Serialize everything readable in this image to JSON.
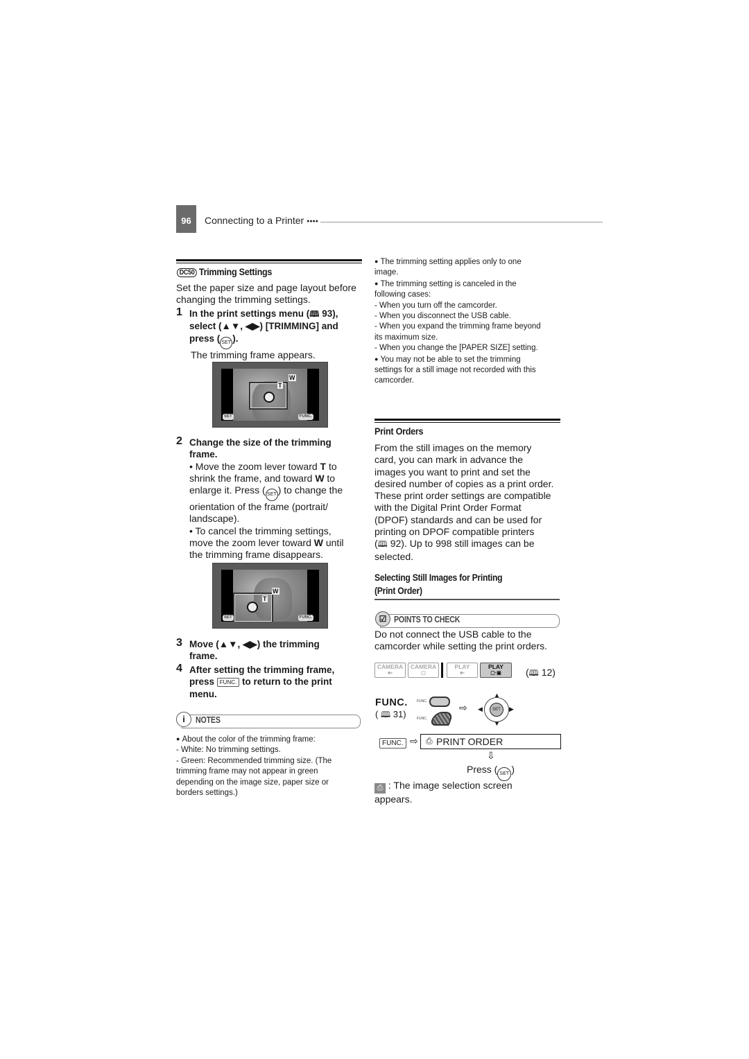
{
  "header": {
    "page_number": "96",
    "chapter_title": "Connecting to a Printer",
    "chapter_dots": "●●●●"
  },
  "trimming": {
    "model_badge": "DC50",
    "title": "Trimming Settings",
    "intro": "Set the paper size and page layout before changing the trimming settings.",
    "steps": [
      {
        "number": "1",
        "line1_a": "In the print settings menu (",
        "line1_ref": "93),",
        "line2_a": "select (▲▼, ◀▶) [TRIMMING] and",
        "line3_a": "press (",
        "line3_b": ").",
        "result": "The trimming frame appears."
      },
      {
        "number": "2",
        "line1": "Change the size of the trimming",
        "line2": "frame.",
        "bullet1_l1_a": "• Move the zoom lever toward ",
        "bullet1_l1_b": "T",
        "bullet1_l1_c": " to",
        "bullet1_l2_a": "shrink the frame, and toward ",
        "bullet1_l2_b": "W",
        "bullet1_l2_c": " to",
        "bullet1_l3_a": "enlarge it. Press (",
        "bullet1_l3_b": ") to change the",
        "bullet1_l4": "orientation of the frame (portrait/",
        "bullet1_l5": "landscape).",
        "bullet2_l1": "• To cancel the trimming settings,",
        "bullet2_l2_a": "move the zoom lever toward ",
        "bullet2_l2_b": "W",
        "bullet2_l2_c": " until",
        "bullet2_l3": "the trimming frame disappears."
      },
      {
        "number": "3",
        "line1": "Move (▲▼, ◀▶) the trimming",
        "line2": "frame."
      },
      {
        "number": "4",
        "line1": "After setting the trimming frame,",
        "line2_a": "press ",
        "line2_key": "FUNC.",
        "line2_b": " to return to the print",
        "line3": "menu."
      }
    ],
    "screen_labels": {
      "set": "SET",
      "func": "FUNC.",
      "w": "W",
      "t": "T"
    }
  },
  "notes": {
    "icon": "i",
    "title": "NOTES",
    "items": [
      "About the color of the trimming frame:",
      "-  White: No trimming settings.",
      "-  Green: Recommended trimming size. (The",
      "trimming frame may not appear in green",
      "depending on the image size, paper size or",
      "borders settings.)"
    ]
  },
  "right_notes": {
    "lines": [
      "The trimming setting applies only to one",
      "image.",
      "The trimming setting is canceled in the",
      "following cases:",
      "-  When you turn off the camcorder.",
      "-  When you disconnect the USB cable.",
      "-  When you expand the trimming frame beyond",
      "its maximum size.",
      "-  When you change the [PAPER SIZE] setting.",
      "You may not be able to set the trimming",
      "settings for a still image not recorded with this",
      "camcorder."
    ]
  },
  "print_orders": {
    "title": "Print Orders",
    "body": [
      "From the still images on the memory",
      "card, you can mark in advance the",
      "images you want to print and set the",
      "desired number of copies as a print order.",
      "These print order settings are compatible",
      "with the Digital Print Order Format",
      "(DPOF) standards and can be used for",
      "printing on DPOF compatible printers",
      "92). Up to 998 still images can be",
      "selected."
    ],
    "subsection_title_1": "Selecting Still Images for Printing",
    "subsection_title_2": "(Print Order)",
    "check_title": "POINTS TO CHECK",
    "check_text_1": "Do not connect the USB cable to the",
    "check_text_2": "camcorder while setting the print orders.",
    "modes": [
      {
        "top": "CAMERA",
        "bottom": "■▪",
        "active": false
      },
      {
        "top": "CAMERA",
        "bottom": "▢",
        "active": false
      },
      {
        "top": "PLAY",
        "bottom": "■▪",
        "active": false
      },
      {
        "top": "PLAY",
        "bottom": "▢·▣",
        "active": true
      }
    ],
    "mode_ref": "12)",
    "func_label": "FUNC.",
    "func_ref": "31)",
    "func_small_1": "FUNC.",
    "func_small_2": "FUNC.",
    "menu_func_key": "FUNC.",
    "menu_item": "PRINT ORDER",
    "press_a": "Press (",
    "press_b": ")",
    "set_label": "SET",
    "result_1": ": The image selection screen",
    "result_2": "appears."
  },
  "glyphs": {
    "book": "🕮",
    "arrow_right": "⇨",
    "arrow_down": "⇩",
    "set": "SET",
    "check": "☑"
  }
}
